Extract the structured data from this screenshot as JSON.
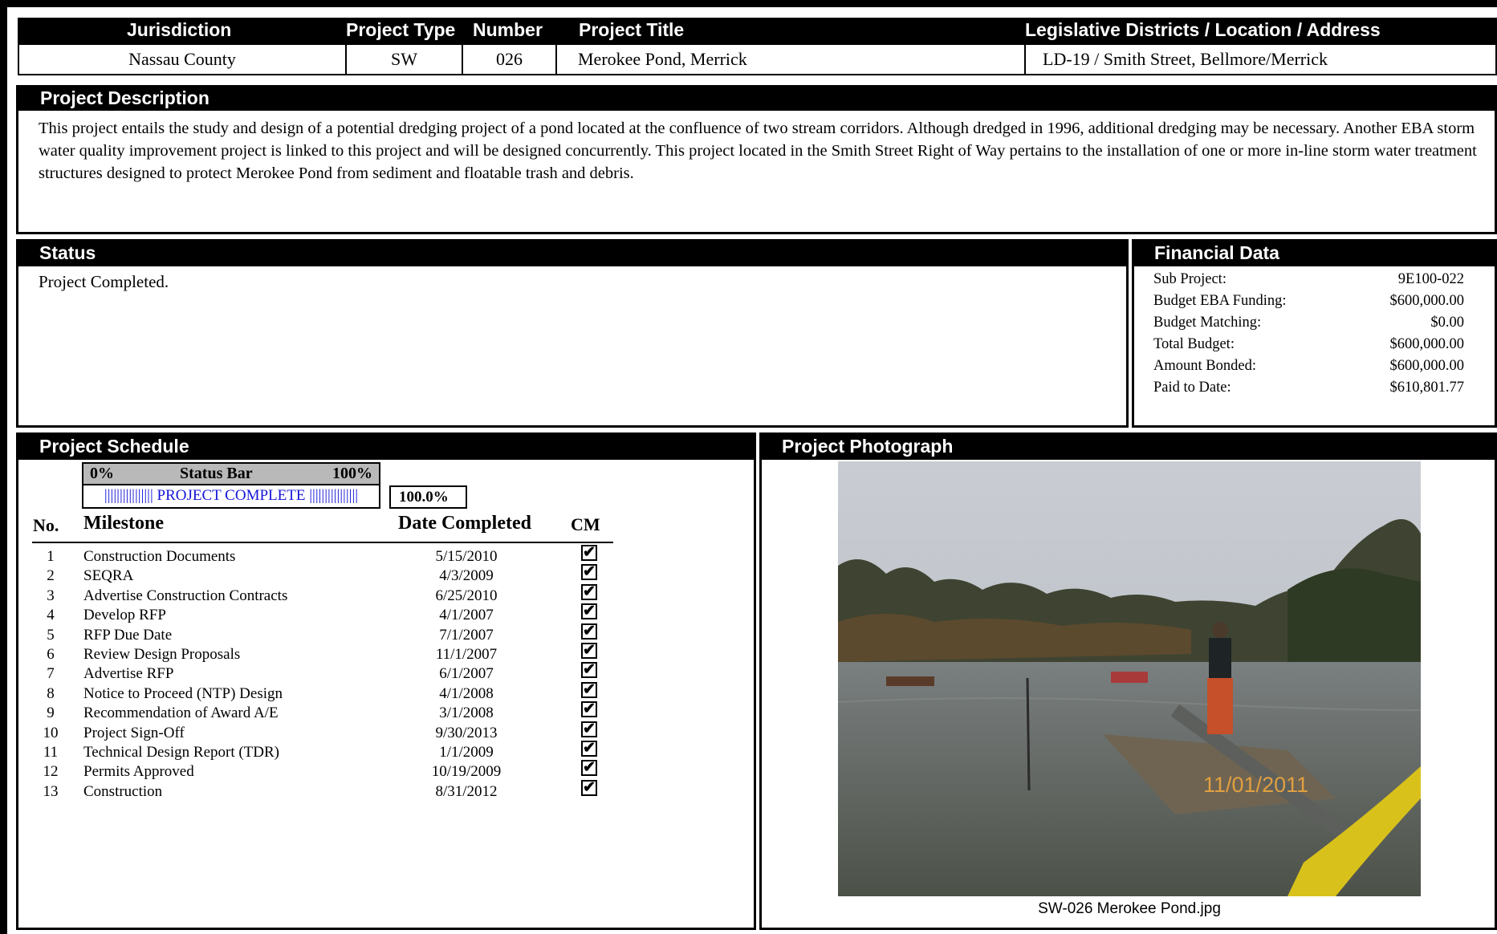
{
  "header": {
    "jurisdiction_label": "Jurisdiction",
    "project_type_label": "Project Type",
    "number_label": "Number",
    "project_title_label": "Project Title",
    "location_label": "Legislative Districts / Location / Address",
    "jurisdiction": "Nassau County",
    "project_type": "SW",
    "number": "026",
    "project_title": "Merokee Pond, Merrick",
    "location": "LD-19 / Smith Street, Bellmore/Merrick"
  },
  "description": {
    "title": "Project Description",
    "text": "This project entails the study and design of a potential dredging project of a pond located at the confluence of two stream corridors.  Although dredged in 1996, additional dredging may be necessary.  Another EBA storm water quality improvement project is linked to this project and will be designed concurrently.  This project located in the Smith Street Right of Way pertains to the installation of one or more in-line storm water treatment structures designed to protect  Merokee Pond from sediment and floatable trash and debris."
  },
  "status": {
    "title": "Status",
    "text": "Project Completed."
  },
  "financial": {
    "title": "Financial Data",
    "rows": [
      {
        "label": "Sub Project:",
        "value": "9E100-022"
      },
      {
        "label": "Budget EBA Funding:",
        "value": "$600,000.00"
      },
      {
        "label": "Budget Matching:",
        "value": "$0.00"
      },
      {
        "label": "Total Budget:",
        "value": "$600,000.00"
      },
      {
        "label": "Amount Bonded:",
        "value": "$600,000.00"
      },
      {
        "label": "Paid to Date:",
        "value": "$610,801.77"
      }
    ]
  },
  "schedule": {
    "title": "Project Schedule",
    "bar_left": "0%",
    "bar_title": "Status Bar",
    "bar_right": "100%",
    "bar_text": "|||||||||||||||| PROJECT COMPLETE ||||||||||||||||",
    "progress": 1.0,
    "percent": "100.0%",
    "col_no": "No.",
    "col_milestone": "Milestone",
    "col_date": "Date Completed",
    "col_cm": "CM",
    "milestones": [
      {
        "no": "1",
        "name": "Construction Documents",
        "date": "5/15/2010",
        "cm": true
      },
      {
        "no": "2",
        "name": "SEQRA",
        "date": "4/3/2009",
        "cm": true
      },
      {
        "no": "3",
        "name": "Advertise Construction Contracts",
        "date": "6/25/2010",
        "cm": true
      },
      {
        "no": "4",
        "name": "Develop RFP",
        "date": "4/1/2007",
        "cm": true
      },
      {
        "no": "5",
        "name": "RFP Due Date",
        "date": "7/1/2007",
        "cm": true
      },
      {
        "no": "6",
        "name": "Review Design Proposals",
        "date": "11/1/2007",
        "cm": true
      },
      {
        "no": "7",
        "name": "Advertise RFP",
        "date": "6/1/2007",
        "cm": true
      },
      {
        "no": "8",
        "name": "Notice to Proceed (NTP) Design",
        "date": "4/1/2008",
        "cm": true
      },
      {
        "no": "9",
        "name": "Recommendation of Award A/E",
        "date": "3/1/2008",
        "cm": true
      },
      {
        "no": "10",
        "name": "Project Sign-Off",
        "date": "9/30/2013",
        "cm": true
      },
      {
        "no": "11",
        "name": "Technical Design Report (TDR)",
        "date": "1/1/2009",
        "cm": true
      },
      {
        "no": "12",
        "name": "Permits Approved",
        "date": "10/19/2009",
        "cm": true
      },
      {
        "no": "13",
        "name": "Construction",
        "date": "8/31/2012",
        "cm": true
      }
    ]
  },
  "photo": {
    "title": "Project Photograph",
    "timestamp": "11/01/2011",
    "caption": "SW-026 Merokee Pond.jpg"
  },
  "colors": {
    "header_bg": "#000000",
    "status_bar_bg": "#b9b9b9",
    "status_bar_text": "#1515d8"
  }
}
